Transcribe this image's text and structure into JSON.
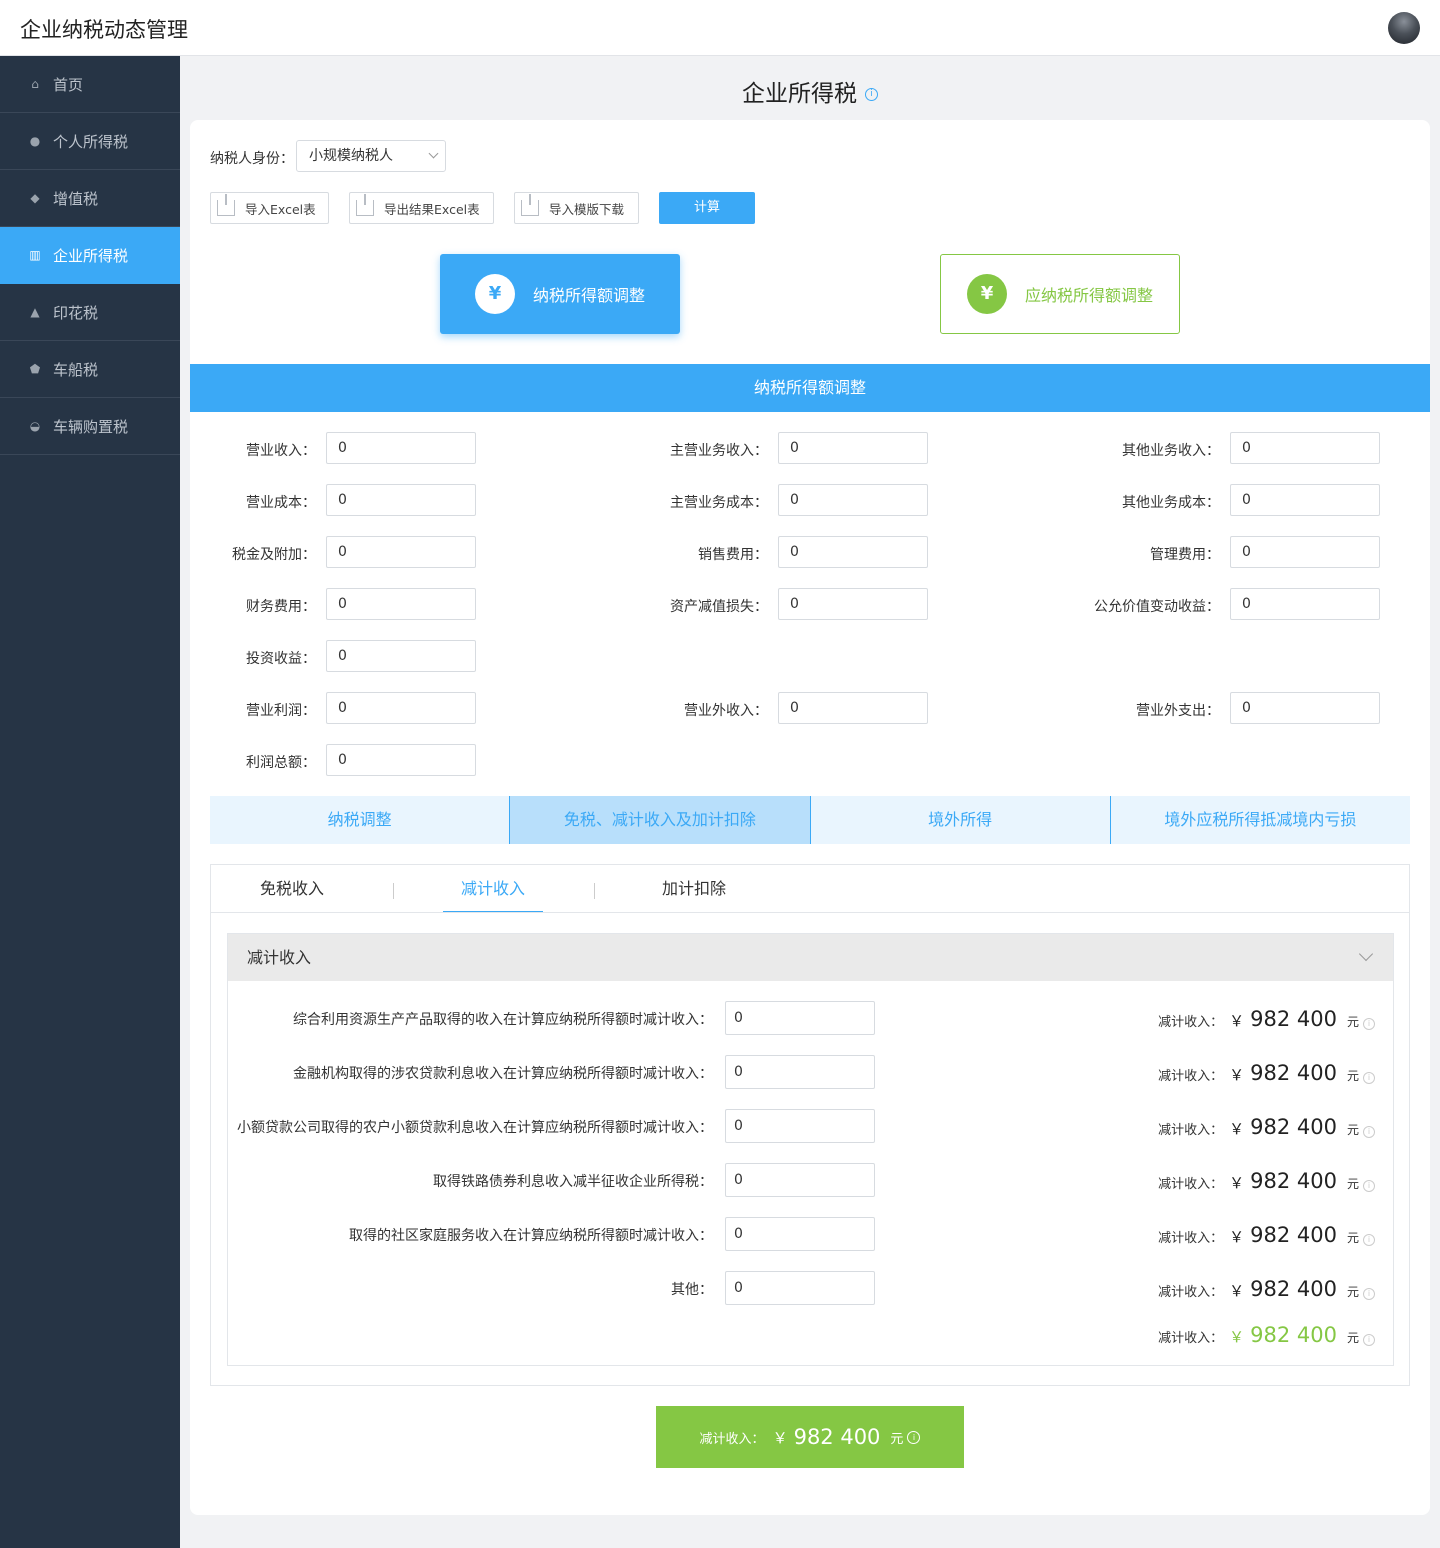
{
  "app": {
    "title": "企业纳税动态管理"
  },
  "sidebar": {
    "items": [
      {
        "label": "首页",
        "icon": "home-icon",
        "glyph": "⌂"
      },
      {
        "label": "个人所得税",
        "icon": "user-icon",
        "glyph": "●"
      },
      {
        "label": "增值税",
        "icon": "diamond-icon",
        "glyph": "◆"
      },
      {
        "label": "企业所得税",
        "icon": "building-icon",
        "glyph": "▥"
      },
      {
        "label": "印花税",
        "icon": "stamp-icon",
        "glyph": "▲"
      },
      {
        "label": "车船税",
        "icon": "ship-icon",
        "glyph": "⬟"
      },
      {
        "label": "车辆购置税",
        "icon": "car-icon",
        "glyph": "◒"
      }
    ],
    "active_index": 3
  },
  "page": {
    "title": "企业所得税",
    "info_glyph": "i"
  },
  "taxpayer": {
    "label": "纳税人身份：",
    "value": "小规模纳税人"
  },
  "toolbar": {
    "import_excel": "导入Excel表",
    "export_excel": "导出结果Excel表",
    "download_template": "导入模版下载",
    "calculate": "计算"
  },
  "modes": {
    "taxable_income_adjust": "纳税所得额调整",
    "payable_income_adjust": "应纳税所得额调整",
    "coin_glyph": "¥"
  },
  "section": {
    "title": "纳税所得额调整"
  },
  "fields": {
    "operating_revenue": {
      "label": "营业收入：",
      "value": "0"
    },
    "main_business_revenue": {
      "label": "主营业务收入：",
      "value": "0"
    },
    "other_business_revenue": {
      "label": "其他业务收入：",
      "value": "0"
    },
    "operating_cost": {
      "label": "营业成本：",
      "value": "0"
    },
    "main_business_cost": {
      "label": "主营业务成本：",
      "value": "0"
    },
    "other_business_cost": {
      "label": "其他业务成本：",
      "value": "0"
    },
    "taxes_surcharges": {
      "label": "税金及附加：",
      "value": "0"
    },
    "selling_expenses": {
      "label": "销售费用：",
      "value": "0"
    },
    "admin_expenses": {
      "label": "管理费用：",
      "value": "0"
    },
    "finance_expenses": {
      "label": "财务费用：",
      "value": "0"
    },
    "asset_impairment": {
      "label": "资产减值损失：",
      "value": "0"
    },
    "fair_value_change": {
      "label": "公允价值变动收益：",
      "value": "0"
    },
    "investment_income": {
      "label": "投资收益：",
      "value": "0"
    },
    "operating_profit": {
      "label": "营业利润：",
      "value": "0"
    },
    "non_operating_income": {
      "label": "营业外收入：",
      "value": "0"
    },
    "non_operating_expense": {
      "label": "营业外支出：",
      "value": "0"
    },
    "total_profit": {
      "label": "利润总额：",
      "value": "0"
    }
  },
  "tabs": [
    {
      "label": "纳税调整"
    },
    {
      "label": "免税、减计收入及加计扣除"
    },
    {
      "label": "境外所得"
    },
    {
      "label": "境外应税所得抵减境内亏损"
    }
  ],
  "active_tab": 1,
  "subtabs": [
    {
      "label": "免税收入"
    },
    {
      "label": "减计收入"
    },
    {
      "label": "加计扣除"
    }
  ],
  "active_subtab": 1,
  "panel": {
    "title": "减计收入",
    "rows": [
      {
        "label": "综合利用资源生产产品取得的收入在计算应纳税所得额时减计收入：",
        "value": "0",
        "result_label": "减计收入：",
        "currency": "￥",
        "amount": "982 400",
        "unit": "元"
      },
      {
        "label": "金融机构取得的涉农贷款利息收入在计算应纳税所得额时减计收入：",
        "value": "0",
        "result_label": "减计收入：",
        "currency": "￥",
        "amount": "982 400",
        "unit": "元"
      },
      {
        "label": "小额贷款公司取得的农户小额贷款利息收入在计算应纳税所得额时减计收入：",
        "value": "0",
        "result_label": "减计收入：",
        "currency": "￥",
        "amount": "982 400",
        "unit": "元"
      },
      {
        "label": "取得铁路债券利息收入减半征收企业所得税：",
        "value": "0",
        "result_label": "减计收入：",
        "currency": "￥",
        "amount": "982 400",
        "unit": "元"
      },
      {
        "label": "取得的社区家庭服务收入在计算应纳税所得额时减计收入：",
        "value": "0",
        "result_label": "减计收入：",
        "currency": "￥",
        "amount": "982 400",
        "unit": "元"
      },
      {
        "label": "其他：",
        "value": "0",
        "result_label": "减计收入：",
        "currency": "￥",
        "amount": "982 400",
        "unit": "元"
      }
    ],
    "total": {
      "result_label": "减计收入：",
      "currency": "￥",
      "amount": "982 400",
      "unit": "元"
    }
  },
  "summary": {
    "label": "减计收入：",
    "currency": "￥",
    "amount": "982 400",
    "unit": "元"
  },
  "colors": {
    "primary": "#3ba9f6",
    "success": "#85c744",
    "sidebar": "#263445"
  }
}
